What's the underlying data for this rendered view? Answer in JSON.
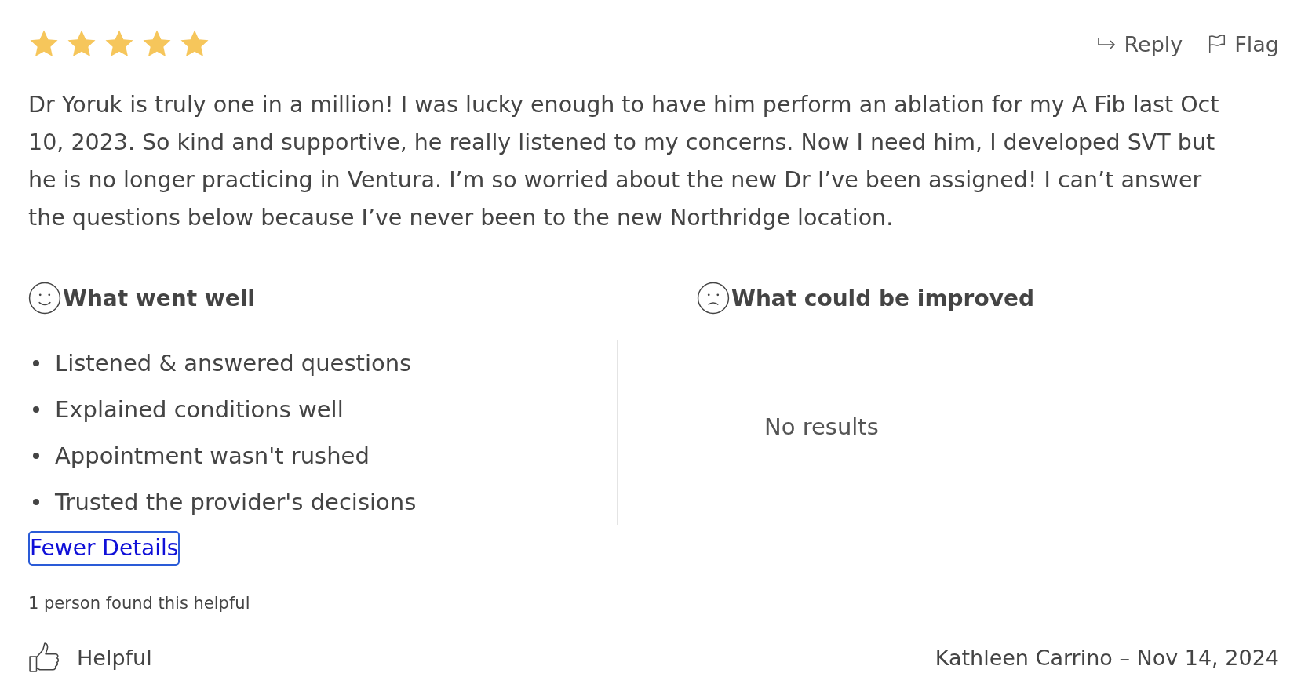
{
  "review": {
    "stars": 5,
    "actions": [
      {
        "kind": "reply",
        "label": "Reply"
      },
      {
        "kind": "flag",
        "label": "Flag"
      }
    ],
    "text": "Dr Yoruk is truly one in a million! I was lucky enough to have him perform an ablation for my A Fib last Oct 10, 2023. So kind and supportive, he really listened to my concerns. Now I need him, I developed SVT but he is no longer practicing in Ventura. I’m so worried about the new Dr I’ve been assigned! I can’t answer the questions below because I’ve never been to the new Northridge location.",
    "went_well": {
      "title": "What went well",
      "items": [
        "Listened & answered questions",
        "Explained conditions well",
        "Appointment wasn't rushed",
        "Trusted the provider's decisions"
      ]
    },
    "improved": {
      "title": "What could be improved",
      "empty_text": "No results"
    },
    "toggle_link": "Fewer Details",
    "helpful_count": "1 person found this helpful",
    "helpful_button": "Helpful",
    "author_date": "Kathleen Carrino – Nov 14, 2024"
  }
}
